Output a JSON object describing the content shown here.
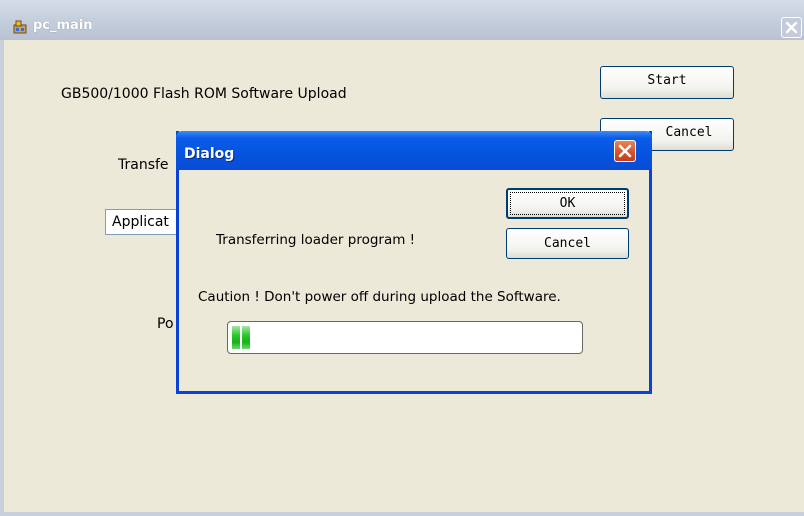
{
  "main_window": {
    "title": "pc_main",
    "heading": "GB500/1000 Flash ROM Software Upload",
    "start_label": "Start",
    "cancel_label": "Cancel",
    "transfer_label_partial": "Transfe",
    "application_partial": "Applicat",
    "port_label_partial": "Po"
  },
  "dialog": {
    "title": "Dialog",
    "ok_label": "OK",
    "cancel_label": "Cancel",
    "status_text": "Transferring loader program !",
    "caution_text": "Caution ! Don't power off during upload the Software.",
    "progress_fraction": 0.06
  },
  "colors": {
    "dialog_title": "#0a5ce8",
    "progress": "#2cc82c",
    "close_button": "#d8542c"
  }
}
